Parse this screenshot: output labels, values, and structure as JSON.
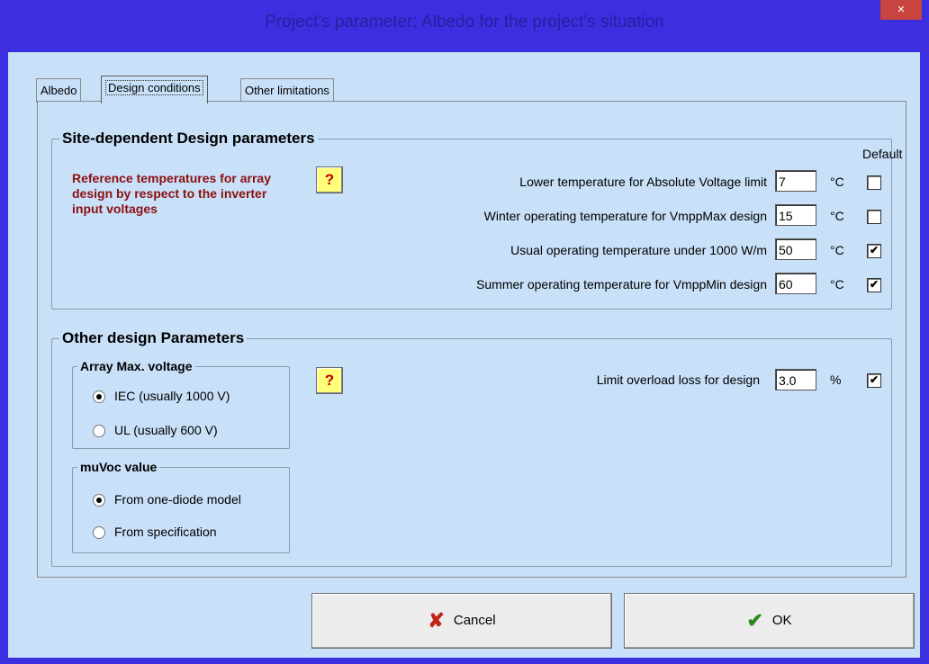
{
  "window": {
    "title": "Project's parameter: Albedo for the project's situation",
    "close_glyph": "×"
  },
  "tabs": [
    {
      "label": "Albedo"
    },
    {
      "label": "Design conditions"
    },
    {
      "label": "Other limitations"
    }
  ],
  "site_group": {
    "title": "Site-dependent Design parameters",
    "reference_text": "Reference temperatures for array design by respect to the inverter input voltages",
    "help_glyph": "?",
    "default_label": "Default",
    "rows": [
      {
        "label": "Lower temperature for Absolute Voltage  limit",
        "value": "7",
        "unit": "°C",
        "checked": false
      },
      {
        "label": "Winter operating temperature for VmppMax design",
        "value": "15",
        "unit": "°C",
        "checked": false
      },
      {
        "label": "Usual operating temperature under 1000 W/m",
        "value": "50",
        "unit": "°C",
        "checked": true
      },
      {
        "label": "Summer operating temperature for VmppMin design",
        "value": "60",
        "unit": "°C",
        "checked": true
      }
    ]
  },
  "other_group": {
    "title": "Other design Parameters",
    "help_glyph": "?",
    "array_max_voltage": {
      "title": "Array Max. voltage",
      "options": [
        {
          "label": "IEC  (usually 1000 V)",
          "selected": true
        },
        {
          "label": "UL   (usually 600 V)",
          "selected": false
        }
      ]
    },
    "muvoc": {
      "title": "muVoc value",
      "options": [
        {
          "label": "From one-diode model",
          "selected": true
        },
        {
          "label": "From specification",
          "selected": false
        }
      ]
    },
    "overload": {
      "label": "Limit overload loss for design",
      "value": "3.0",
      "unit": "%",
      "checked": true
    }
  },
  "buttons": {
    "cancel": {
      "label": "Cancel",
      "icon": "red-x-icon",
      "glyph": "✘",
      "color": "#c0261a"
    },
    "ok": {
      "label": "OK",
      "icon": "green-check-icon",
      "glyph": "✔",
      "color": "#2a8a1a"
    }
  },
  "colors": {
    "frame": "#3b2fe0",
    "client_bg": "#c8e0f8",
    "reference_text": "#8b1010",
    "help_bg": "#ffff7a",
    "close_bg": "#c7443f"
  }
}
